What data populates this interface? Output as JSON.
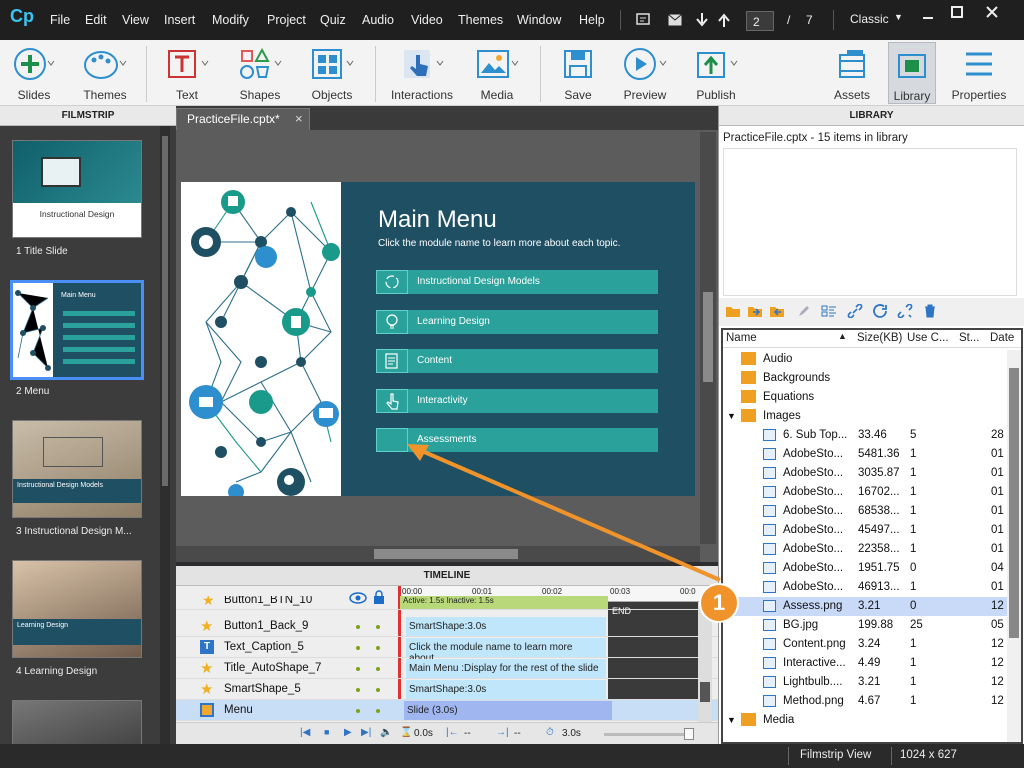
{
  "app": {
    "logo": "Cp"
  },
  "menu": [
    "File",
    "Edit",
    "View",
    "Insert",
    "Modify",
    "Project",
    "Quiz",
    "Audio",
    "Video",
    "Themes",
    "Window",
    "Help"
  ],
  "pagenav": {
    "current": "2",
    "separator": "/",
    "total": "7"
  },
  "workspace": "Classic",
  "toolbar": {
    "slides": "Slides",
    "themes": "Themes",
    "text": "Text",
    "shapes": "Shapes",
    "objects": "Objects",
    "interactions": "Interactions",
    "media": "Media",
    "save": "Save",
    "preview": "Preview",
    "publish": "Publish",
    "assets": "Assets",
    "library": "Library",
    "properties": "Properties"
  },
  "filmstrip": {
    "title": "FILMSTRIP",
    "slides": [
      {
        "label": "1 Title Slide",
        "caption": "Instructional Design"
      },
      {
        "label": "2 Menu",
        "caption": "Main Menu"
      },
      {
        "label": "3 Instructional Design M...",
        "caption": "Instructional Design Models"
      },
      {
        "label": "4 Learning Design",
        "caption": "Learning Design"
      }
    ]
  },
  "tab": {
    "label": "PracticeFile.cptx*",
    "close": "×"
  },
  "slide": {
    "title": "Main Menu",
    "subtitle": "Click the module name to learn more about each topic.",
    "items": [
      "Instructional Design Models",
      "Learning Design",
      "Content",
      "Interactivity",
      "Assessments"
    ]
  },
  "timeline": {
    "title": "TIMELINE",
    "ticks": [
      "00:00",
      "00:01",
      "00:02",
      "00:03",
      "00:0"
    ],
    "rows": [
      {
        "name": "Button1_BTN_10",
        "bar": "Active: 1.5s   Inactive: 1.5s"
      },
      {
        "name": "Button1_Back_9",
        "bar": "SmartShape:3.0s"
      },
      {
        "name": "Text_Caption_5",
        "bar": "Click the module name to learn more about..."
      },
      {
        "name": "Title_AutoShape_7",
        "bar": "Main Menu :Display for the rest of the slide"
      },
      {
        "name": "SmartShape_5",
        "bar": "SmartShape:3.0s"
      },
      {
        "name": "Menu",
        "bar": "Slide (3.0s)"
      }
    ],
    "end": "END",
    "footer": {
      "t1": "0.0s",
      "t2": "--",
      "t3": "--",
      "t4": "3.0s"
    }
  },
  "library": {
    "title": "LIBRARY",
    "summary": "PracticeFile.cptx - 15 items in library",
    "columns": [
      "Name",
      "Size(KB)",
      "Use C...",
      "St...",
      "Date"
    ],
    "folders": [
      "Audio",
      "Backgrounds",
      "Equations",
      "Images",
      "Media"
    ],
    "items": [
      {
        "name": "6. Sub Top...",
        "size": "33.46",
        "use": "5",
        "date": "28"
      },
      {
        "name": "AdobeSto...",
        "size": "5481.36",
        "use": "1",
        "date": "01"
      },
      {
        "name": "AdobeSto...",
        "size": "3035.87",
        "use": "1",
        "date": "01"
      },
      {
        "name": "AdobeSto...",
        "size": "16702...",
        "use": "1",
        "date": "01"
      },
      {
        "name": "AdobeSto...",
        "size": "68538...",
        "use": "1",
        "date": "01"
      },
      {
        "name": "AdobeSto...",
        "size": "45497...",
        "use": "1",
        "date": "01"
      },
      {
        "name": "AdobeSto...",
        "size": "22358...",
        "use": "1",
        "date": "01"
      },
      {
        "name": "AdobeSto...",
        "size": "1951.75",
        "use": "0",
        "date": "04"
      },
      {
        "name": "AdobeSto...",
        "size": "46913...",
        "use": "1",
        "date": "01"
      },
      {
        "name": "Assess.png",
        "size": "3.21",
        "use": "0",
        "date": "12"
      },
      {
        "name": "BG.jpg",
        "size": "199.88",
        "use": "25",
        "date": "05"
      },
      {
        "name": "Content.png",
        "size": "3.24",
        "use": "1",
        "date": "12"
      },
      {
        "name": "Interactive...",
        "size": "4.49",
        "use": "1",
        "date": "12"
      },
      {
        "name": "Lightbulb....",
        "size": "3.21",
        "use": "1",
        "date": "12"
      },
      {
        "name": "Method.png",
        "size": "4.67",
        "use": "1",
        "date": "12"
      }
    ]
  },
  "callout": {
    "number": "1"
  },
  "status": {
    "view": "Filmstrip View",
    "size": "1024 x 627"
  },
  "colors": {
    "accent": "#f0932b",
    "slide_bg": "#1f4f63",
    "teal": "#2aa19a",
    "selection": "#c9daf8"
  }
}
